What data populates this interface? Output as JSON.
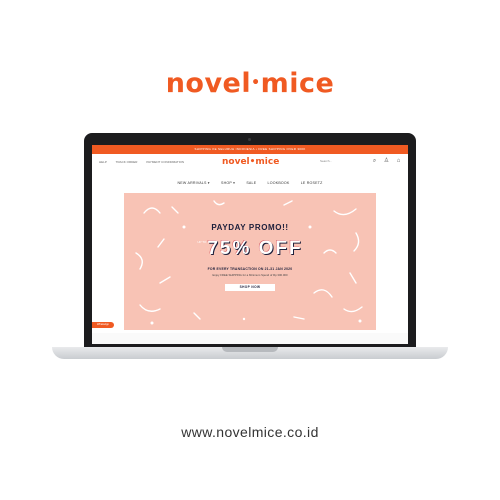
{
  "brand": {
    "logo_left": "novel",
    "logo_dot": "•",
    "logo_right": "mice"
  },
  "site": {
    "announcement": "SHIPPING KE SELURUH INDONESIA • FREE SHIPPING OVER 300K",
    "utility_links": [
      "HELP",
      "TRACK ORDER",
      "PAYMENT CONFIRMATION"
    ],
    "logo": "novel•mice",
    "search_placeholder": "Search...",
    "nav": [
      "NEW ARRIVALS ▾",
      "SHOP ▾",
      "SALE",
      "LOOKBOOK",
      "LE ROSETZ"
    ]
  },
  "hero": {
    "title": "PAYDAY PROMO!!",
    "upto": "UP TO",
    "discount": "75% OFF",
    "line1": "FOR EVERY TRANSACTION ON 21-31 JAN 2020",
    "line2": "Enjoy FREE SHIPPING for a Minimum Spend of Rp 300.000",
    "cta": "SHOP NOW",
    "bg_color": "#f8c3b5"
  },
  "whatsapp_label": "WhatsApp",
  "website_url": "www.novelmice.co.id",
  "colors": {
    "brand_orange": "#f05a22",
    "navy": "#1d1f3b"
  },
  "icons": {
    "search": "search-icon",
    "account": "user-icon",
    "cart": "cart-icon"
  }
}
